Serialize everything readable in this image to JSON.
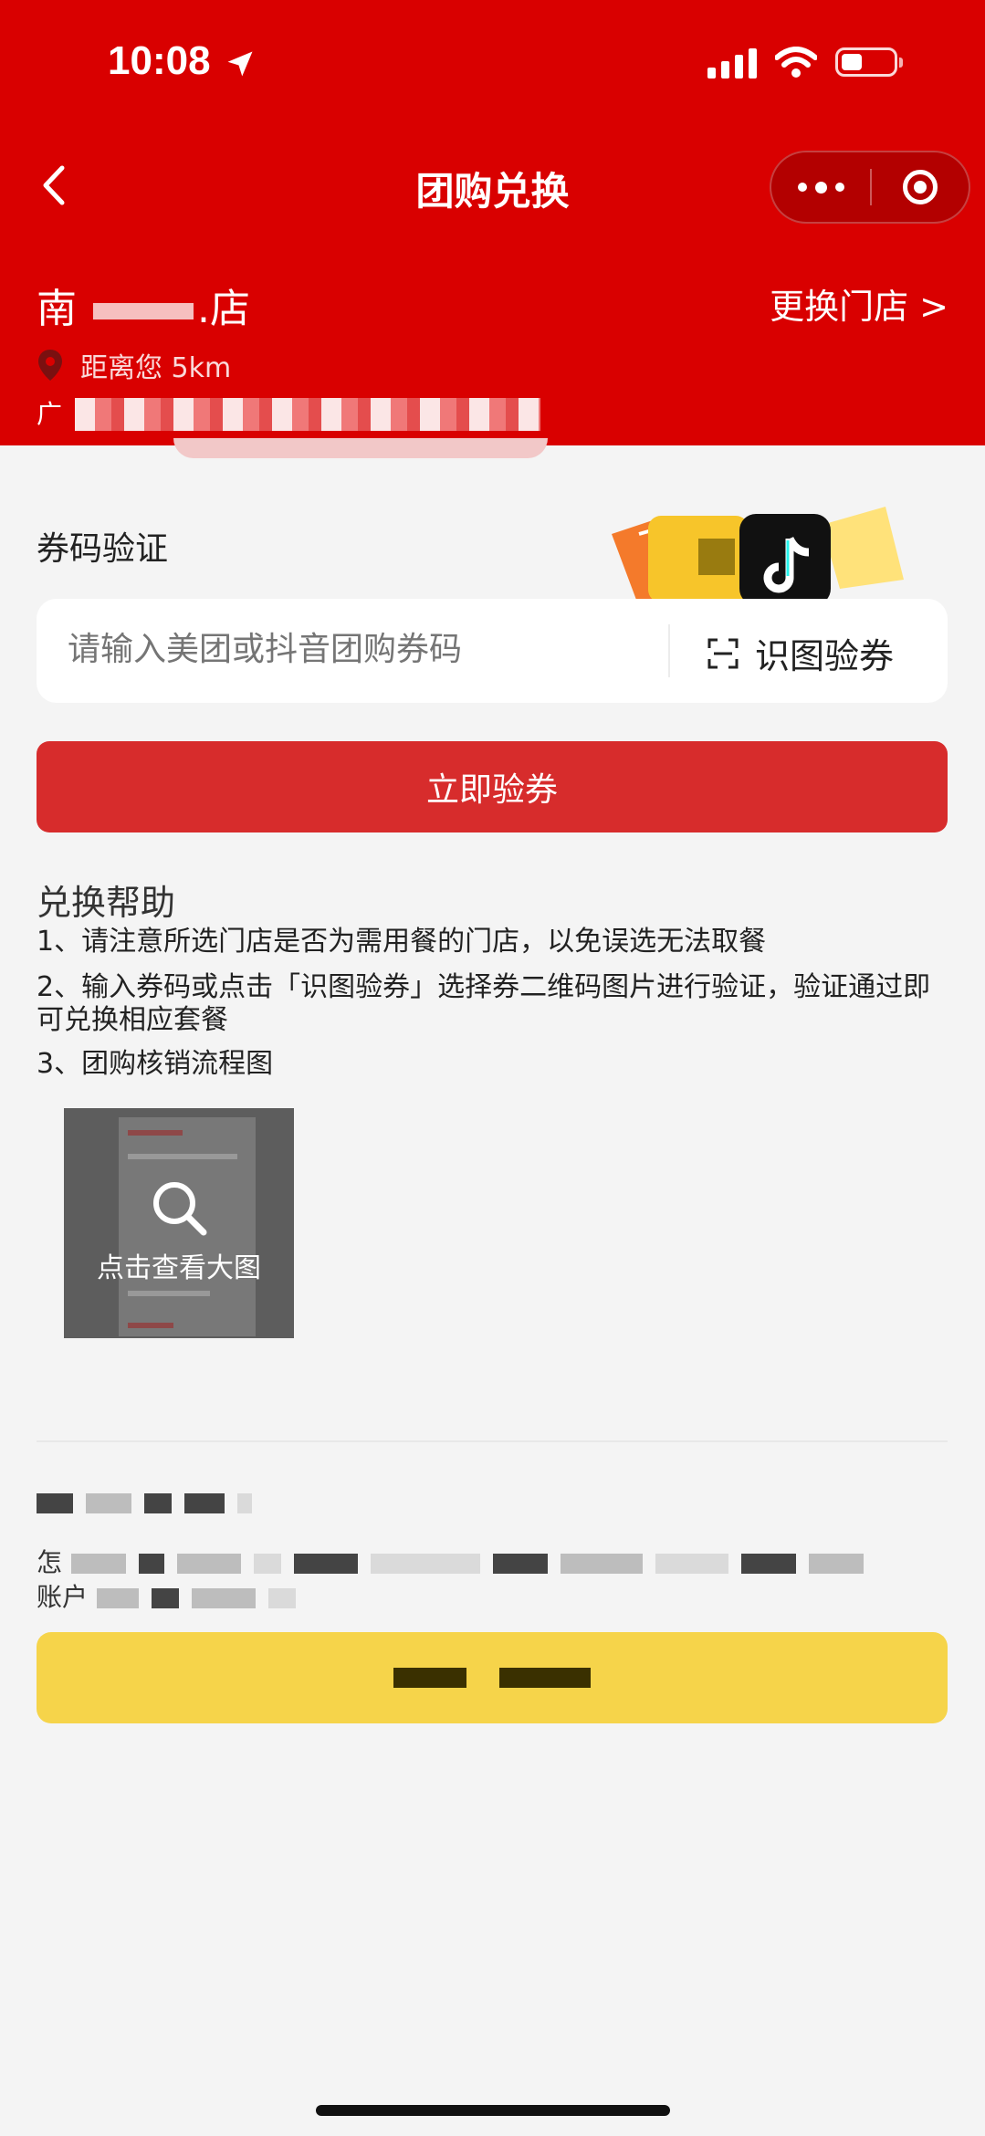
{
  "status_bar": {
    "time": "10:08"
  },
  "nav": {
    "title": "团购兑换"
  },
  "store": {
    "name_prefix": "南",
    "name_suffix": ".店",
    "change_label": "更换门店  >",
    "distance": "距离您 5km",
    "address_prefix": "广"
  },
  "coupon": {
    "section_title": "券码验证",
    "input_placeholder": "请输入美团或抖音团购券码",
    "scan_label": "识图验券",
    "verify_button": "立即验券"
  },
  "help": {
    "title": "兑换帮助",
    "items": [
      "1、请注意所选门店是否为需用餐的门店，以免误选无法取餐",
      "2、输入券码或点击「识图验券」选择券二维码图片进行验证，验证通过即可兑换相应套餐",
      "3、团购核销流程图"
    ],
    "thumb_label": "点击查看大图"
  },
  "footer": {
    "line2_prefix": "怎",
    "line3_prefix": "账户"
  },
  "colors": {
    "header_red": "#d90000",
    "button_red": "#d72c2c",
    "yellow": "#f6d44a"
  }
}
